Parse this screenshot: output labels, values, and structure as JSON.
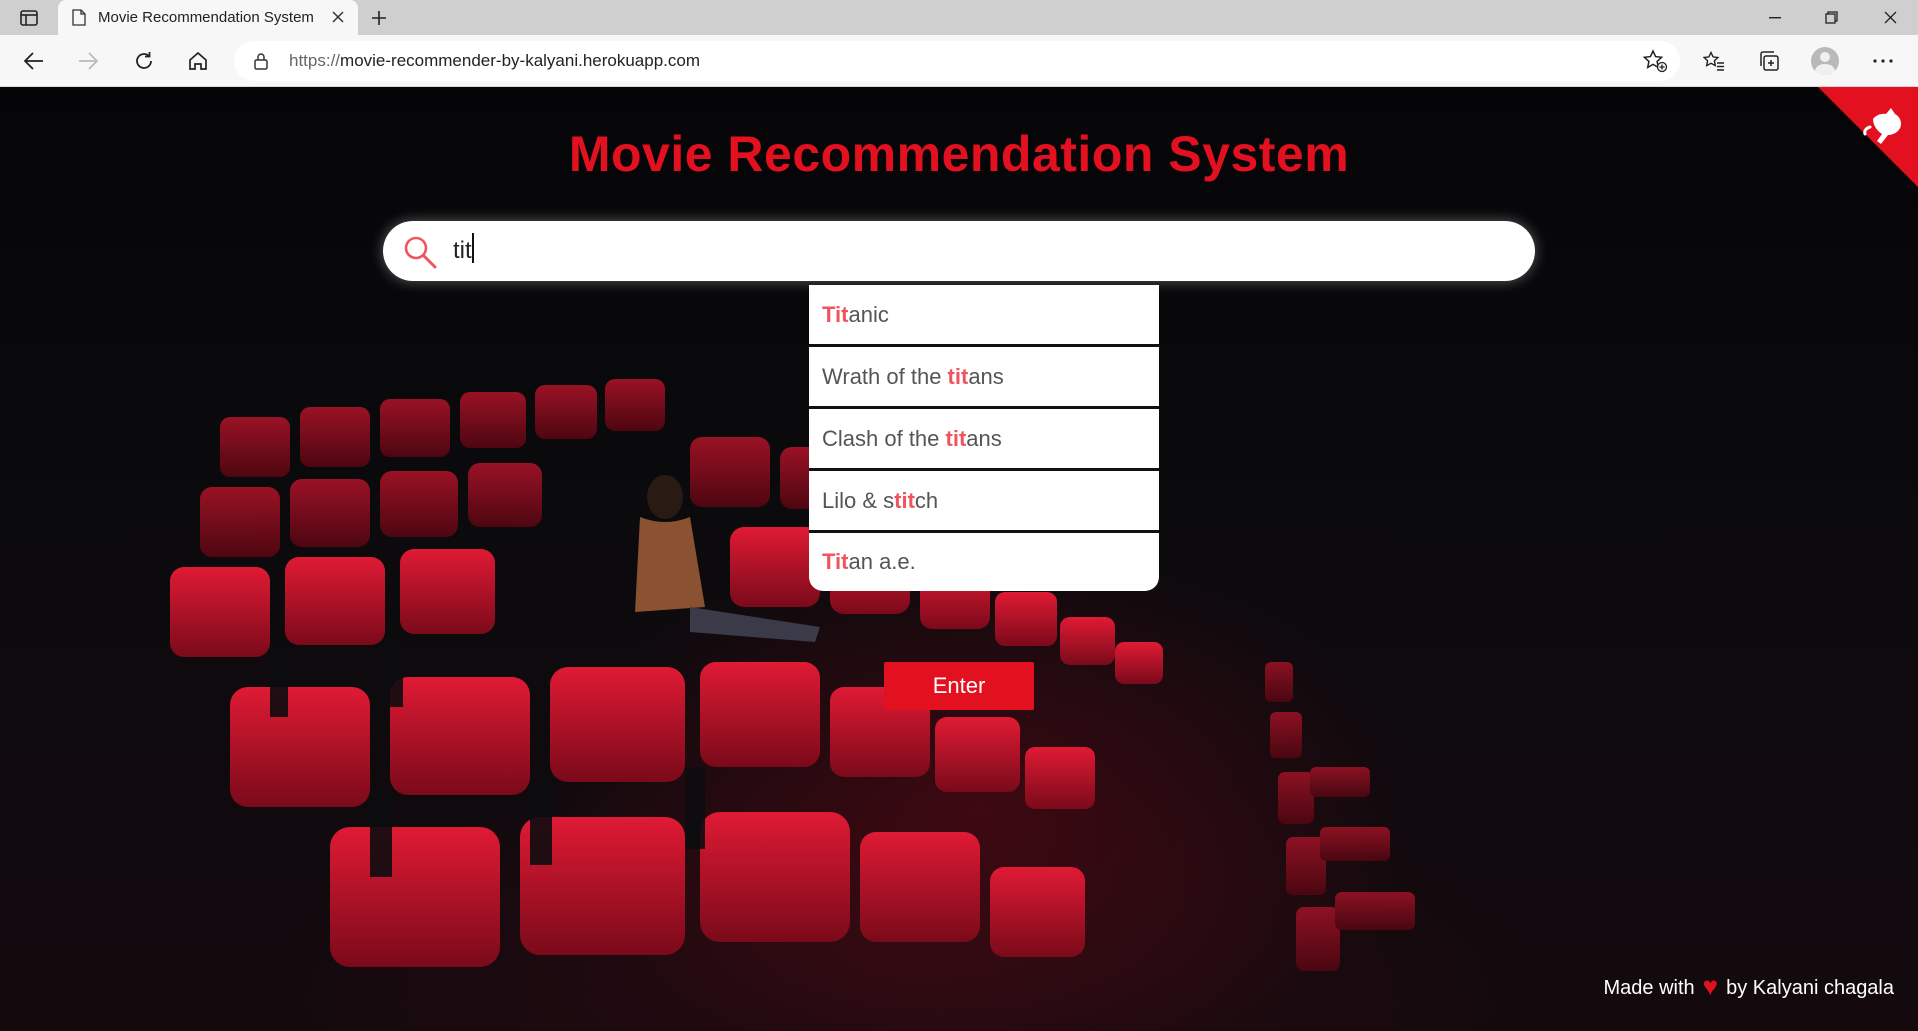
{
  "browser": {
    "tab_title": "Movie Recommendation System",
    "url_protocol": "https://",
    "url_host": "movie-recommender-by-kalyani.herokuapp.com"
  },
  "page": {
    "title": "Movie Recommendation System",
    "search_value": "tit",
    "enter_label": "Enter",
    "footer_prefix": "Made with",
    "footer_suffix": "by Kalyani chagala",
    "colors": {
      "accent": "#e3101f",
      "highlight": "#f0545f"
    }
  },
  "suggestions": [
    {
      "pre": "",
      "match": "Tit",
      "post": "anic"
    },
    {
      "pre": "Wrath of the ",
      "match": "tit",
      "post": "ans"
    },
    {
      "pre": "Clash of the ",
      "match": "tit",
      "post": "ans"
    },
    {
      "pre": "Lilo & s",
      "match": "tit",
      "post": "ch"
    },
    {
      "pre": "",
      "match": "Tit",
      "post": "an a.e."
    }
  ]
}
